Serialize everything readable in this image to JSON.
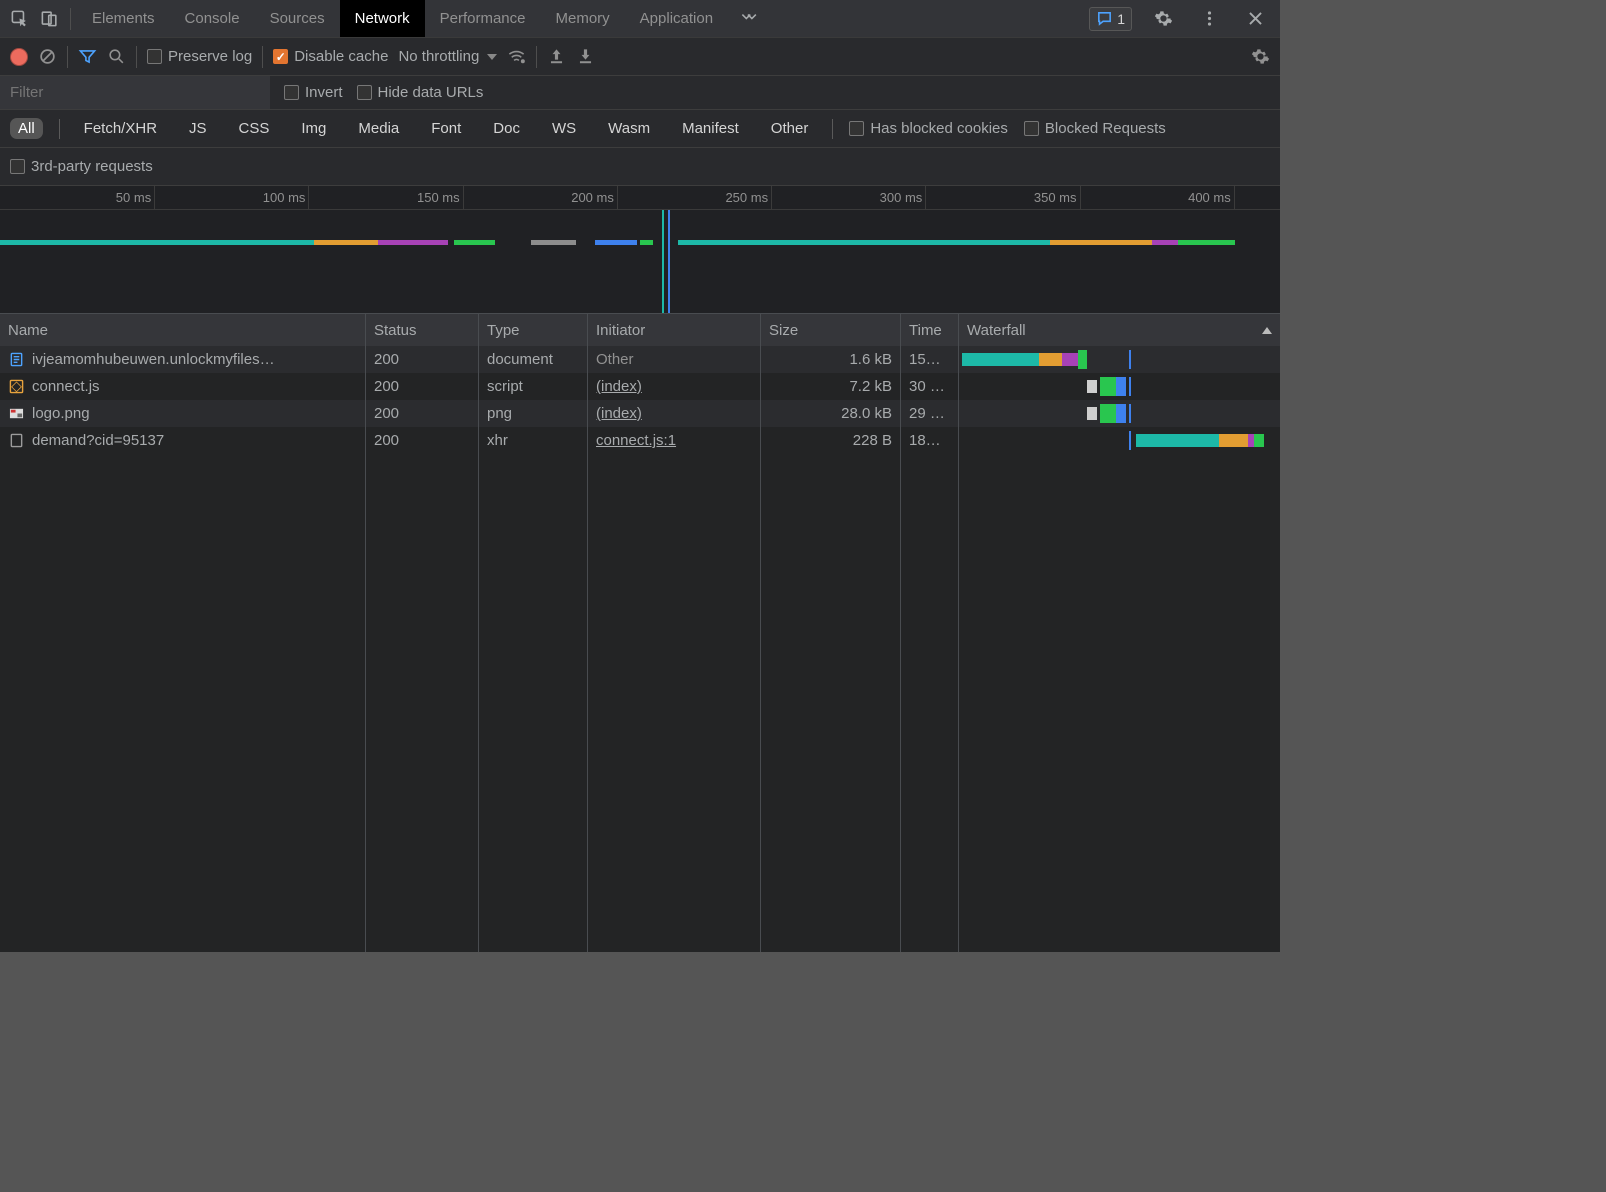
{
  "tabs": {
    "items": [
      "Elements",
      "Console",
      "Sources",
      "Network",
      "Performance",
      "Memory",
      "Application"
    ],
    "active": 3,
    "messageCount": "1"
  },
  "toolbar": {
    "preserve_log": "Preserve log",
    "disable_cache": "Disable cache",
    "throttling": "No throttling"
  },
  "filter": {
    "placeholder": "Filter",
    "invert": "Invert",
    "hide_data_urls": "Hide data URLs",
    "types": [
      "All",
      "Fetch/XHR",
      "JS",
      "CSS",
      "Img",
      "Media",
      "Font",
      "Doc",
      "WS",
      "Wasm",
      "Manifest",
      "Other"
    ],
    "active_type": 0,
    "has_blocked": "Has blocked cookies",
    "blocked_req": "Blocked Requests",
    "third_party": "3rd-party requests"
  },
  "overview": {
    "ticks": [
      "50 ms",
      "100 ms",
      "150 ms",
      "200 ms",
      "250 ms",
      "300 ms",
      "350 ms",
      "400 ms"
    ]
  },
  "table": {
    "headers": {
      "name": "Name",
      "status": "Status",
      "type": "Type",
      "initiator": "Initiator",
      "size": "Size",
      "time": "Time",
      "waterfall": "Waterfall"
    },
    "rows": [
      {
        "icon": "doc",
        "name": "ivjeamomhubeuwen.unlockmyfiles…",
        "status": "200",
        "type": "document",
        "initiator": "Other",
        "initiator_link": false,
        "size": "1.6 kB",
        "time": "15…"
      },
      {
        "icon": "js",
        "name": "connect.js",
        "status": "200",
        "type": "script",
        "initiator": "(index)",
        "initiator_link": true,
        "size": "7.2 kB",
        "time": "30 …"
      },
      {
        "icon": "img",
        "name": "logo.png",
        "status": "200",
        "type": "png",
        "initiator": "(index)",
        "initiator_link": true,
        "size": "28.0 kB",
        "time": "29 …"
      },
      {
        "icon": "xhr",
        "name": "demand?cid=95137",
        "status": "200",
        "type": "xhr",
        "initiator": "connect.js:1",
        "initiator_link": true,
        "size": "228 B",
        "time": "18…"
      }
    ]
  },
  "colors": {
    "teal": "#1db9a8",
    "orange": "#e29d32",
    "purple": "#a742b6",
    "green": "#29c64f",
    "grey": "#8d8d8d",
    "blue": "#3e81ee",
    "ltgrey": "#cfcfcf"
  }
}
